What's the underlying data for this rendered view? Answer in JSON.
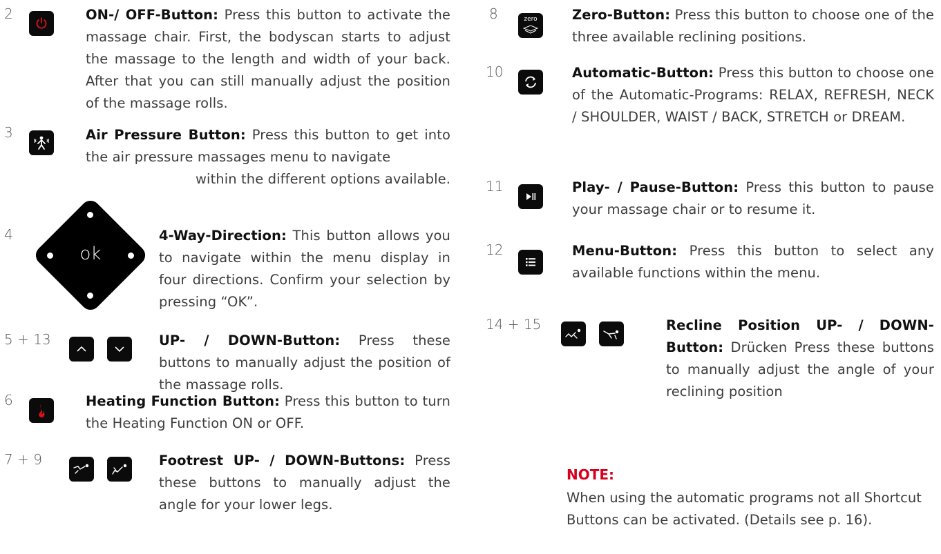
{
  "entries": {
    "onoff": {
      "num": "2",
      "title": "ON-/ OFF-Button:",
      "text": " Press this button to activate the massage chair. First, the bodyscan starts to adjust the massage to the length and width of your back. After that you can still manually adjust the position of the massage rolls."
    },
    "air": {
      "num": "3",
      "title": "Air Pressure Button:",
      "text": " Press this button to get into the air pressure massages menu to navigate",
      "text2": "within the different options available."
    },
    "dir": {
      "num": "4",
      "ok": "ok",
      "title": "4-Way-Direction:",
      "text": " This button allows you to navigate within the menu display in four directions. Confirm your selection by pressing “OK”."
    },
    "updown": {
      "num": "5 + 13",
      "title": "UP- / DOWN-Button:",
      "text": " Press these buttons to manually adjust the position of the massage rolls."
    },
    "heat": {
      "num": "6",
      "title": "Heating Function Button:",
      "text": " Press this button to turn the Heating Function ON or OFF."
    },
    "foot": {
      "num": "7 + 9",
      "title": "Footrest UP- / DOWN-Buttons:",
      "text": " Press these buttons to manually adjust the angle for your lower legs."
    },
    "zero": {
      "num": "8",
      "icon_label": "zero",
      "title": "Zero-Button:",
      "text": " Press this button to choose one of the three available reclining positions."
    },
    "auto": {
      "num": "10",
      "title": "Automatic-Button:",
      "text": " Press this button to choose one of the Automatic-Programs: RELAX, REFRESH, NECK / SHOULDER, WAIST / BACK, STRETCH or DREAM."
    },
    "play": {
      "num": "11",
      "title": "Play- / Pause-Button:",
      "text": " Press this button to pause your massage chair or to resume it."
    },
    "menu": {
      "num": "12",
      "title": "Menu-Button:",
      "text": " Press this button to select any available functions within the menu."
    },
    "recline": {
      "num": "14 + 15",
      "title": "Recline Position UP- / DOWN-Button:",
      "text": " Drücken Press these buttons to manually adjust the angle of your reclining position"
    }
  },
  "note": {
    "head": "NOTE:",
    "text": "When using the automatic programs not all Shortcut Buttons can be activated. (Details see p. 16)."
  },
  "colors": {
    "accent_red": "#d6001c",
    "button_black": "#0b0b0b",
    "text": "#3d3d3d"
  }
}
